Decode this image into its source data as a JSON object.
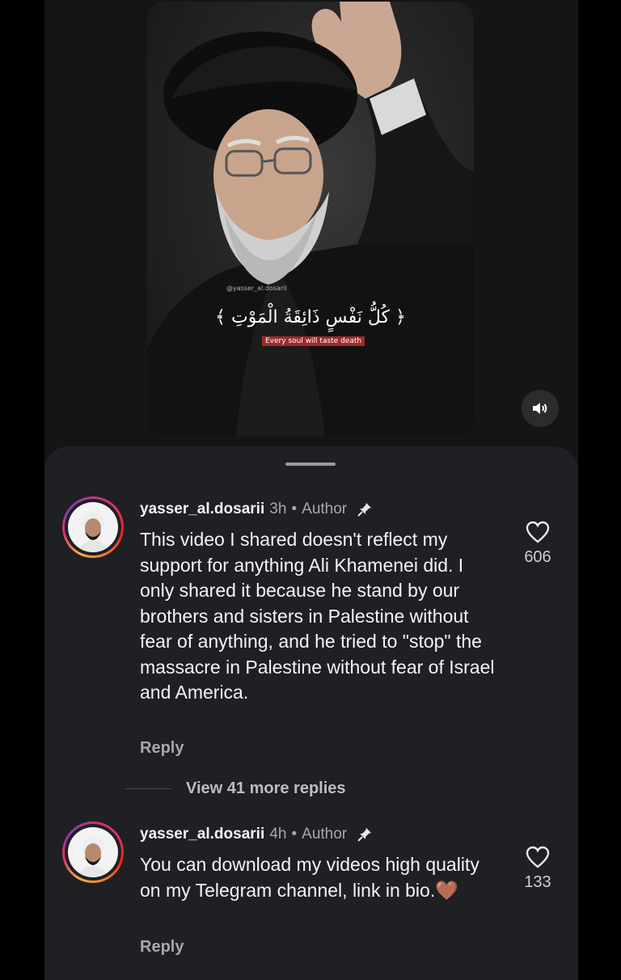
{
  "video": {
    "watermark": "@yasser_al.dosarii",
    "arabic_text": "﴿ كُلُّ نَفْسٍ ذَائِقَةُ الْمَوْتِ ﴾",
    "translation": "Every soul will taste death",
    "sound_icon": "speaker-icon"
  },
  "comments": [
    {
      "username": "yasser_al.dosarii",
      "time": "3h",
      "badge": "Author",
      "text": "This video I shared doesn't reflect my support for anything Ali Khamenei did. I only shared it because he stand by our brothers and sisters in Palestine without fear of anything, and he tried to \"stop\" the massacre in Palestine without fear of Israel and America.",
      "reply": "Reply",
      "likes": "606"
    },
    {
      "username": "yasser_al.dosarii",
      "time": "4h",
      "badge": "Author",
      "text": "You can download my videos high quality on my Telegram channel, link in bio.🤎",
      "reply": "Reply",
      "likes": "133"
    }
  ],
  "view_more": "View 41 more replies",
  "colors": {
    "sheet": "#1e2023",
    "secondary_text": "#a8a8a8",
    "translation_bg": "#9e2a2a"
  }
}
